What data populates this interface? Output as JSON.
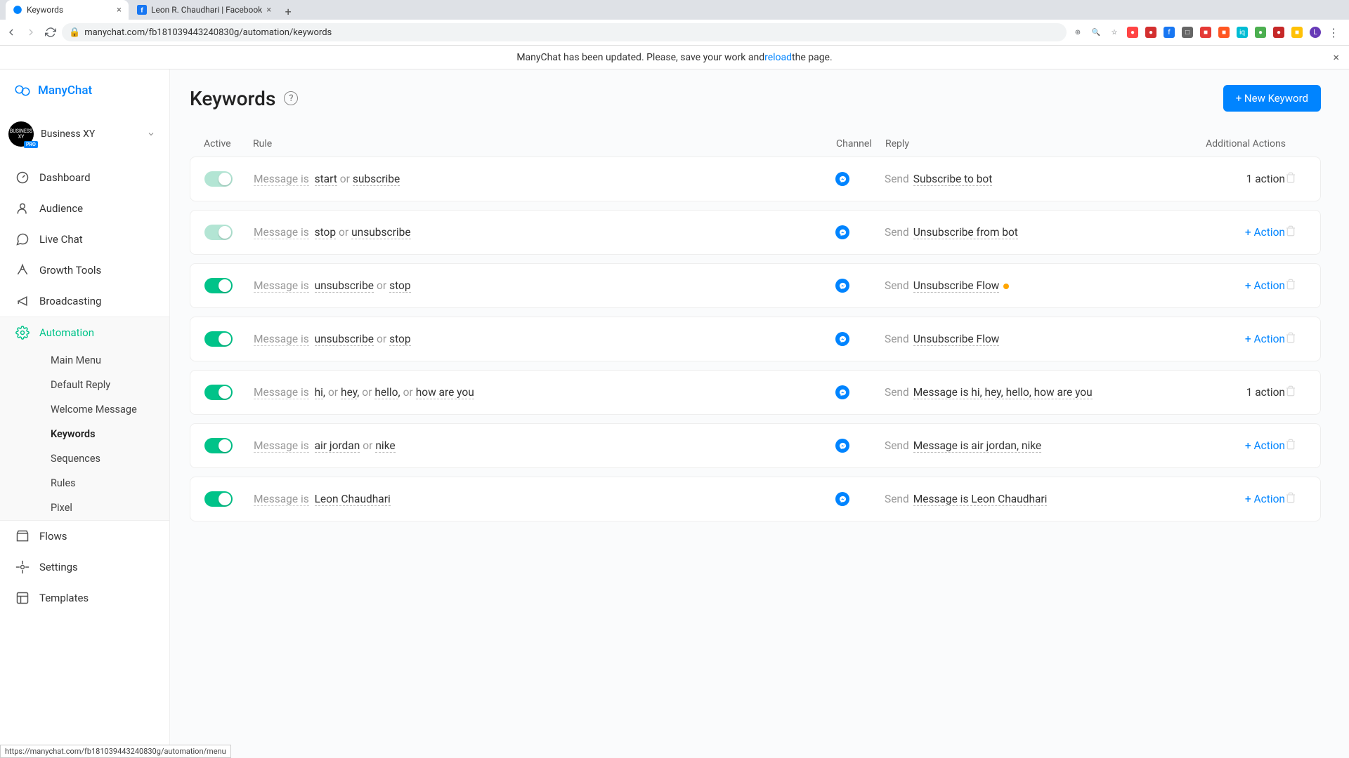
{
  "browser": {
    "tabs": [
      {
        "title": "Keywords",
        "active": true,
        "favicon": "manychat"
      },
      {
        "title": "Leon R. Chaudhari | Facebook",
        "active": false,
        "favicon": "facebook"
      }
    ],
    "url": "manychat.com/fb181039443240830g/automation/keywords"
  },
  "banner": {
    "text_before": "ManyChat has been updated. Please, save your work and ",
    "link": "reload",
    "text_after": " the page."
  },
  "brand": "ManyChat",
  "workspace": {
    "name": "Business XY",
    "avatar_text": "BUSINESS XY",
    "badge": "PRO"
  },
  "nav": {
    "dashboard": "Dashboard",
    "audience": "Audience",
    "live_chat": "Live Chat",
    "growth_tools": "Growth Tools",
    "broadcasting": "Broadcasting",
    "automation": "Automation",
    "flows": "Flows",
    "settings": "Settings",
    "templates": "Templates"
  },
  "automation_sub": {
    "main_menu": "Main Menu",
    "default_reply": "Default Reply",
    "welcome_message": "Welcome Message",
    "keywords": "Keywords",
    "sequences": "Sequences",
    "rules": "Rules",
    "pixel": "Pixel"
  },
  "page": {
    "title": "Keywords",
    "new_button": "+ New Keyword"
  },
  "columns": {
    "active": "Active",
    "rule": "Rule",
    "channel": "Channel",
    "reply": "Reply",
    "additional": "Additional Actions"
  },
  "labels": {
    "message_is": "Message is",
    "or": "or",
    "send": "Send",
    "add_action": "+ Action",
    "one_action": "1 action"
  },
  "rows": [
    {
      "toggle": "off",
      "keywords": [
        "start",
        "subscribe"
      ],
      "reply": "Subscribe to bot",
      "yellow": false,
      "action_type": "text"
    },
    {
      "toggle": "off",
      "keywords": [
        "stop",
        "unsubscribe"
      ],
      "reply": "Unsubscribe from bot",
      "yellow": false,
      "action_type": "add"
    },
    {
      "toggle": "on",
      "keywords": [
        "unsubscribe",
        "stop"
      ],
      "reply": "Unsubscribe Flow",
      "yellow": true,
      "action_type": "add"
    },
    {
      "toggle": "on",
      "keywords": [
        "unsubscribe",
        "stop"
      ],
      "reply": "Unsubscribe Flow",
      "yellow": false,
      "action_type": "add"
    },
    {
      "toggle": "on",
      "keywords": [
        "hi",
        "hey",
        "hello",
        "how are you"
      ],
      "reply": "Message is hi, hey, hello, how are you",
      "yellow": false,
      "action_type": "text"
    },
    {
      "toggle": "on",
      "keywords": [
        "air jordan",
        "nike"
      ],
      "reply": "Message is air jordan, nike",
      "yellow": false,
      "action_type": "add"
    },
    {
      "toggle": "on",
      "keywords": [
        "Leon Chaudhari"
      ],
      "reply": "Message is Leon Chaudhari",
      "yellow": false,
      "action_type": "add"
    }
  ],
  "status_url": "https://manychat.com/fb181039443240830g/automation/menu"
}
